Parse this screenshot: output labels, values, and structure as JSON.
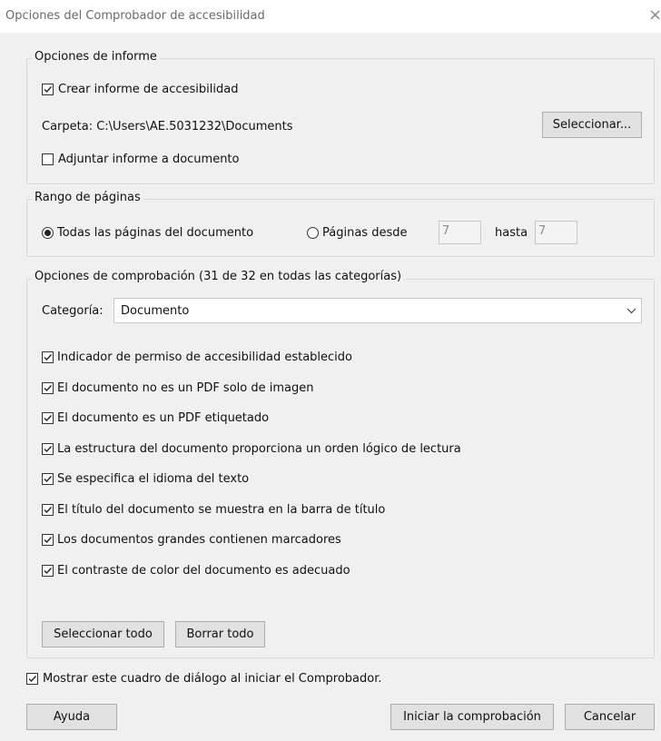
{
  "window": {
    "title": "Opciones del Comprobador de accesibilidad",
    "close": "×"
  },
  "report": {
    "legend": "Opciones de informe",
    "create_report": {
      "label": "Crear informe de accesibilidad",
      "checked": true
    },
    "folder": "Carpeta: C:\\Users\\AE.5031232\\Documents",
    "select_button": "Seleccionar...",
    "attach_report": {
      "label": "Adjuntar informe a documento",
      "checked": false
    }
  },
  "pages": {
    "legend": "Rango de páginas",
    "all_pages": {
      "label": "Todas las páginas del documento",
      "selected": true
    },
    "pages_from": {
      "label": "Páginas desde",
      "selected": false
    },
    "from_value": "7",
    "to_label": "hasta",
    "to_value": "7"
  },
  "checks": {
    "legend": "Opciones de comprobación (31 de 32 en todas las categorías)",
    "category_label": "Categoría:",
    "category_value": "Documento",
    "items": [
      {
        "label": "Indicador de permiso de accesibilidad establecido",
        "checked": true
      },
      {
        "label": "El documento no es un PDF solo de imagen",
        "checked": true
      },
      {
        "label": "El documento es un PDF etiquetado",
        "checked": true
      },
      {
        "label": "La estructura del documento proporciona un orden lógico de lectura",
        "checked": true
      },
      {
        "label": "Se especifica el idioma del texto",
        "checked": true
      },
      {
        "label": "El título del documento se muestra en la barra de título",
        "checked": true
      },
      {
        "label": "Los documentos grandes contienen marcadores",
        "checked": true
      },
      {
        "label": "El contraste de color del documento es adecuado",
        "checked": true
      }
    ],
    "select_all": "Seleccionar todo",
    "clear_all": "Borrar todo"
  },
  "footer": {
    "show_dialog": {
      "label": "Mostrar este cuadro de diálogo al iniciar el Comprobador.",
      "checked": true
    },
    "help": "Ayuda",
    "start": "Iniciar la comprobación",
    "cancel": "Cancelar"
  }
}
